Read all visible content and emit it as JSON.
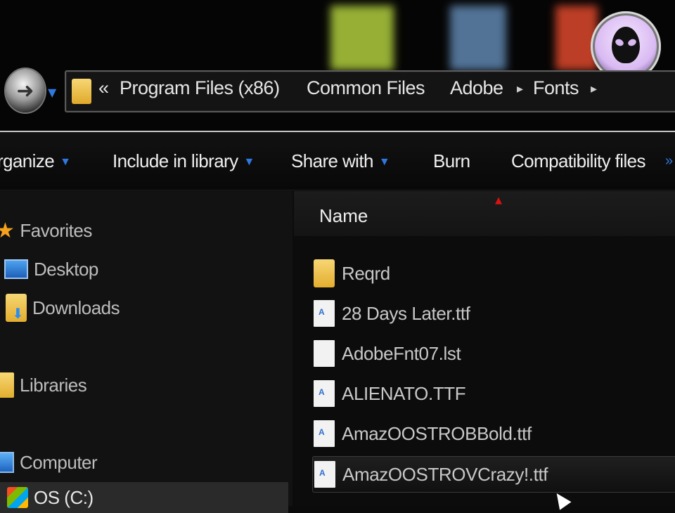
{
  "address": {
    "chevron": "«",
    "segments": [
      "Program Files (x86)",
      "Common Files",
      "Adobe",
      "Fonts"
    ],
    "separator": "▸"
  },
  "toolbar": {
    "organize": "rganize",
    "include": "Include in library",
    "share": "Share with",
    "burn": "Burn",
    "compat": "Compatibility files"
  },
  "nav": {
    "favorites": "Favorites",
    "desktop": "Desktop",
    "downloads": "Downloads",
    "libraries": "Libraries",
    "computer": "Computer",
    "drive": "OS (C:)"
  },
  "files": {
    "column_name": "Name",
    "rows": [
      "Reqrd",
      "28 Days Later.ttf",
      "AdobeFnt07.lst",
      "ALIENATO.TTF",
      "AmazOOSTROBBold.ttf",
      "AmazOOSTROVCrazy!.ttf"
    ]
  },
  "colors": {
    "accent_blue": "#2f78e0",
    "sort_arrow": "#dd1111",
    "folder": "#e8b23a"
  },
  "icons": [
    "back-icon",
    "folder-icon",
    "star-icon",
    "desktop-icon",
    "downloads-icon",
    "libraries-icon",
    "computer-icon",
    "drive-icon",
    "font-file-icon",
    "document-icon",
    "alien-logo-icon"
  ]
}
